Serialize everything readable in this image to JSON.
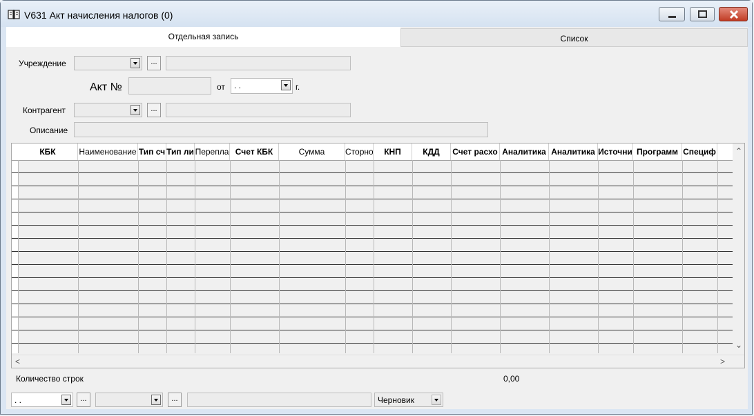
{
  "window": {
    "title": "V631 Акт начисления налогов (0)"
  },
  "tabs": [
    {
      "label": "Отдельная запись",
      "active": true
    },
    {
      "label": "Список",
      "active": false
    }
  ],
  "form": {
    "institution_label": "Учреждение",
    "institution_value": "",
    "institution_name": "",
    "act_label": "Акт №",
    "act_number": "",
    "from_label": "от",
    "act_date": " .  .",
    "year_suffix": "г.",
    "counterparty_label": "Контрагент",
    "counterparty_value": "",
    "counterparty_name": "",
    "description_label": "Описание",
    "description_value": "",
    "ellipsis": "..."
  },
  "grid": {
    "columns": [
      {
        "label": "КБК",
        "bold": true
      },
      {
        "label": "Наименование",
        "bold": false
      },
      {
        "label": "Тип сч",
        "bold": true
      },
      {
        "label": "Тип ли",
        "bold": true
      },
      {
        "label": "Перепла",
        "bold": false
      },
      {
        "label": "Счет КБК",
        "bold": true
      },
      {
        "label": "Сумма",
        "bold": false
      },
      {
        "label": "Сторно",
        "bold": false
      },
      {
        "label": "КНП",
        "bold": true
      },
      {
        "label": "КДД",
        "bold": true
      },
      {
        "label": "Счет расхо",
        "bold": true
      },
      {
        "label": "Аналитика",
        "bold": true
      },
      {
        "label": "Аналитика",
        "bold": true
      },
      {
        "label": "Источни",
        "bold": true
      },
      {
        "label": "Программ",
        "bold": true
      },
      {
        "label": "Специф",
        "bold": true
      }
    ],
    "row_count": 15
  },
  "status": {
    "rows_label": "Количество строк",
    "total_sum": "0,00"
  },
  "bottom": {
    "date_value": " .  .",
    "combo2_value": "",
    "text_value": "",
    "state_value": "Черновик",
    "ellipsis": "..."
  }
}
